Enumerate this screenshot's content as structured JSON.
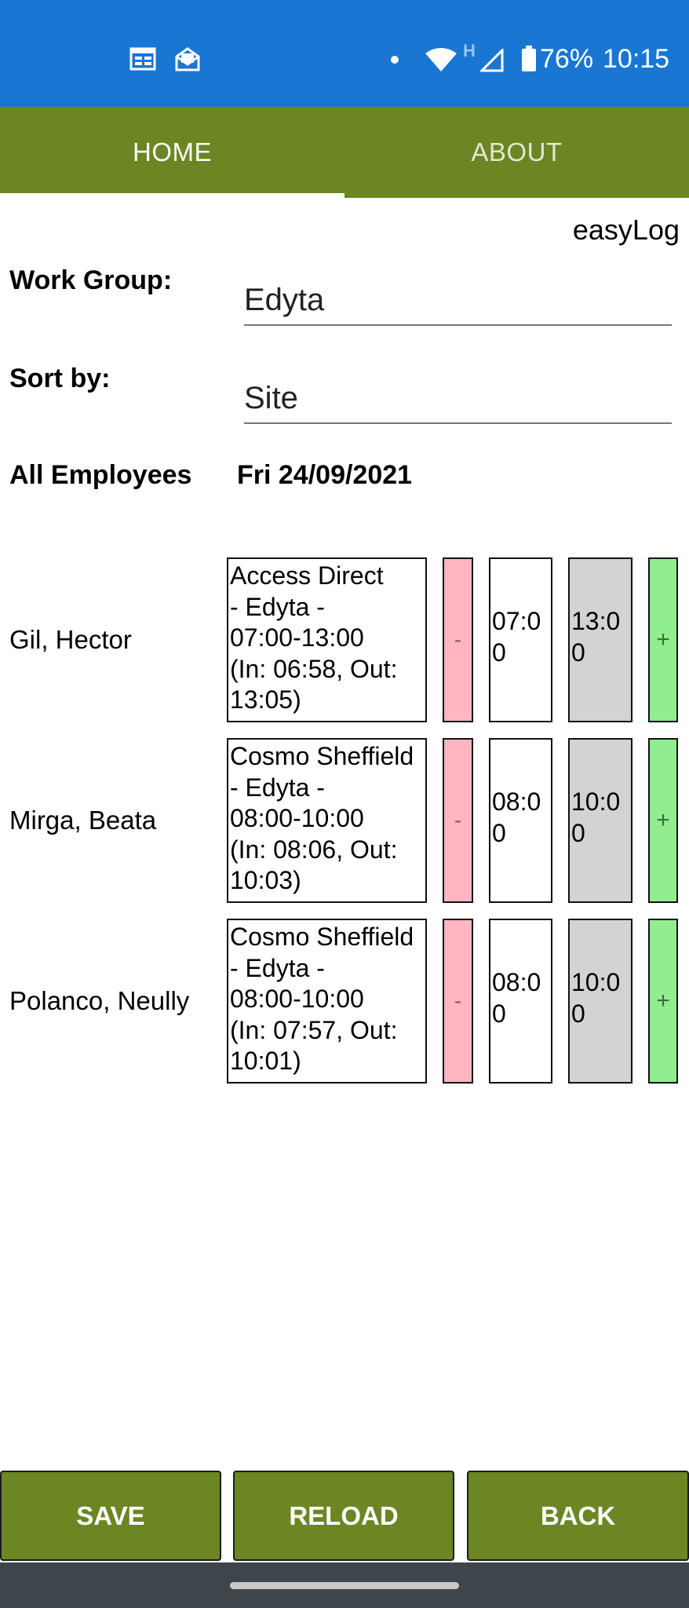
{
  "status_bar": {
    "battery": "76%",
    "time": "10:15",
    "network_badge": "H",
    "icons": [
      "calendar-icon",
      "mail-icon",
      "dot-icon",
      "wifi-icon",
      "signal-icon",
      "battery-icon"
    ],
    "bg_color": "#1976d2"
  },
  "tabs": [
    {
      "label": "HOME",
      "active": true
    },
    {
      "label": "ABOUT",
      "active": false
    }
  ],
  "app_name": "easyLog",
  "form": {
    "work_group_label": "Work Group:",
    "work_group_value": "Edyta",
    "sort_by_label": "Sort by:",
    "sort_by_value": "Site"
  },
  "filter": {
    "employees_label": "All Employees",
    "date": "Fri 24/09/2021"
  },
  "employees": [
    {
      "name": "Gil, Hector",
      "shift": "Access Direct\n- Edyta -\n07:00-13:00\n(In: 06:58, Out:\n13:05)",
      "minus": "-",
      "start": "07:00",
      "end": "13:00",
      "plus": "+"
    },
    {
      "name": "Mirga, Beata",
      "shift": "Cosmo Sheffield\n- Edyta -\n08:00-10:00\n(In: 08:06, Out:\n10:03)",
      "minus": "-",
      "start": "08:00",
      "end": "10:00",
      "plus": "+"
    },
    {
      "name": "Polanco, Neully",
      "shift": "Cosmo Sheffield\n- Edyta -\n08:00-10:00\n(In: 07:57, Out:\n10:01)",
      "minus": "-",
      "start": "08:00",
      "end": "10:00",
      "plus": "+"
    }
  ],
  "buttons": {
    "save": "SAVE",
    "reload": "RELOAD",
    "back": "BACK"
  },
  "colors": {
    "accent": "#6b8623",
    "minus_bg": "#ffb6c1",
    "plus_bg": "#90ee90",
    "end_bg": "#d3d3d3"
  }
}
